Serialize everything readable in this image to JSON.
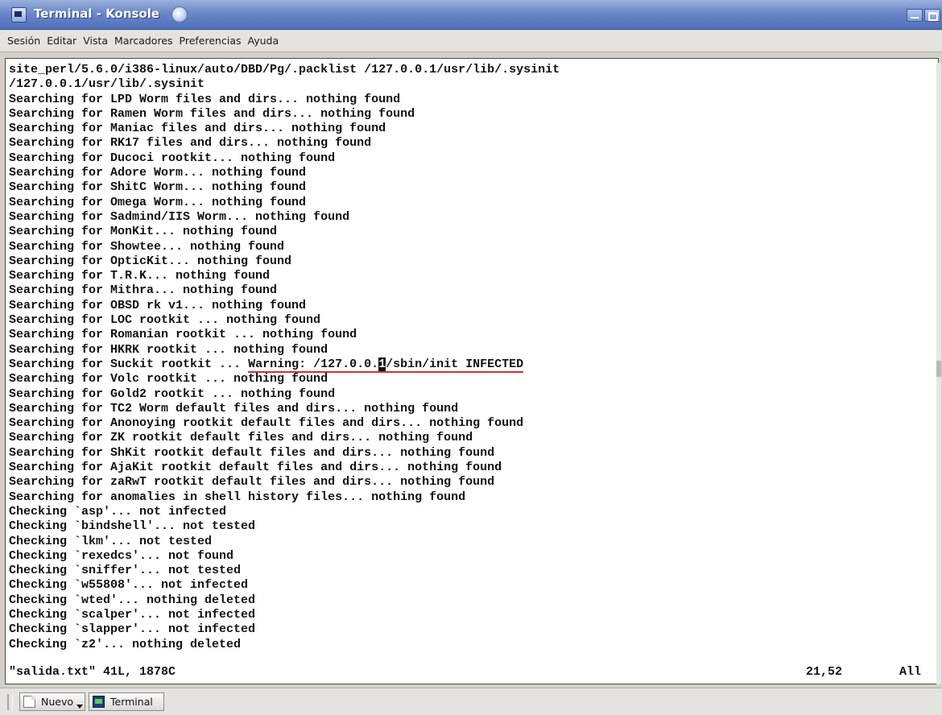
{
  "window": {
    "title": "Terminal - Konsole"
  },
  "menu": [
    "Sesión",
    "Editar",
    "Vista",
    "Marcadores",
    "Preferencias",
    "Ayuda"
  ],
  "terminal": {
    "lines": [
      "site_perl/5.6.0/i386-linux/auto/DBD/Pg/.packlist /127.0.0.1/usr/lib/.sysinit",
      "/127.0.0.1/usr/lib/.sysinit",
      "Searching for LPD Worm files and dirs... nothing found",
      "Searching for Ramen Worm files and dirs... nothing found",
      "Searching for Maniac files and dirs... nothing found",
      "Searching for RK17 files and dirs... nothing found",
      "Searching for Ducoci rootkit... nothing found",
      "Searching for Adore Worm... nothing found",
      "Searching for ShitC Worm... nothing found",
      "Searching for Omega Worm... nothing found",
      "Searching for Sadmind/IIS Worm... nothing found",
      "Searching for MonKit... nothing found",
      "Searching for Showtee... nothing found",
      "Searching for OpticKit... nothing found",
      "Searching for T.R.K... nothing found",
      "Searching for Mithra... nothing found",
      "Searching for OBSD rk v1... nothing found",
      "Searching for LOC rootkit ... nothing found",
      "Searching for Romanian rootkit ... nothing found",
      "Searching for HKRK rootkit ... nothing found",
      {
        "before": "Searching for Suckit rootkit ... ",
        "warn": "Warning: /127.0.0.",
        "cursor": "1",
        "after": "/sbin/init INFECTED"
      },
      "Searching for Volc rootkit ... nothing found",
      "Searching for Gold2 rootkit ... nothing found",
      "Searching for TC2 Worm default files and dirs... nothing found",
      "Searching for Anonoying rootkit default files and dirs... nothing found",
      "Searching for ZK rootkit default files and dirs... nothing found",
      "Searching for ShKit rootkit default files and dirs... nothing found",
      "Searching for AjaKit rootkit default files and dirs... nothing found",
      "Searching for zaRwT rootkit default files and dirs... nothing found",
      "Searching for anomalies in shell history files... nothing found",
      "Checking `asp'... not infected",
      "Checking `bindshell'... not tested",
      "Checking `lkm'... not tested",
      "Checking `rexedcs'... not found",
      "Checking `sniffer'... not tested",
      "Checking `w55808'... not infected",
      "Checking `wted'... nothing deleted",
      "Checking `scalper'... not infected",
      "Checking `slapper'... not infected",
      "Checking `z2'... nothing deleted"
    ],
    "status": {
      "file": "\"salida.txt\" 41L, 1878C",
      "position": "21,52",
      "scroll": "All"
    }
  },
  "taskbar": {
    "new_label": "Nuevo",
    "terminal_label": "Terminal"
  },
  "colors": {
    "titlebar": "#5a78c0",
    "menubar": "#e4e3e0",
    "terminal_bg": "#ffffff",
    "terminal_fg": "#111111",
    "warning_underline": "#d03030"
  },
  "icons": {
    "app": "konsole-icon",
    "sticky": "sticky-icon",
    "minimize": "minimize-icon",
    "maximize": "maximize-icon",
    "new": "new-document-icon",
    "terminal": "terminal-icon"
  }
}
